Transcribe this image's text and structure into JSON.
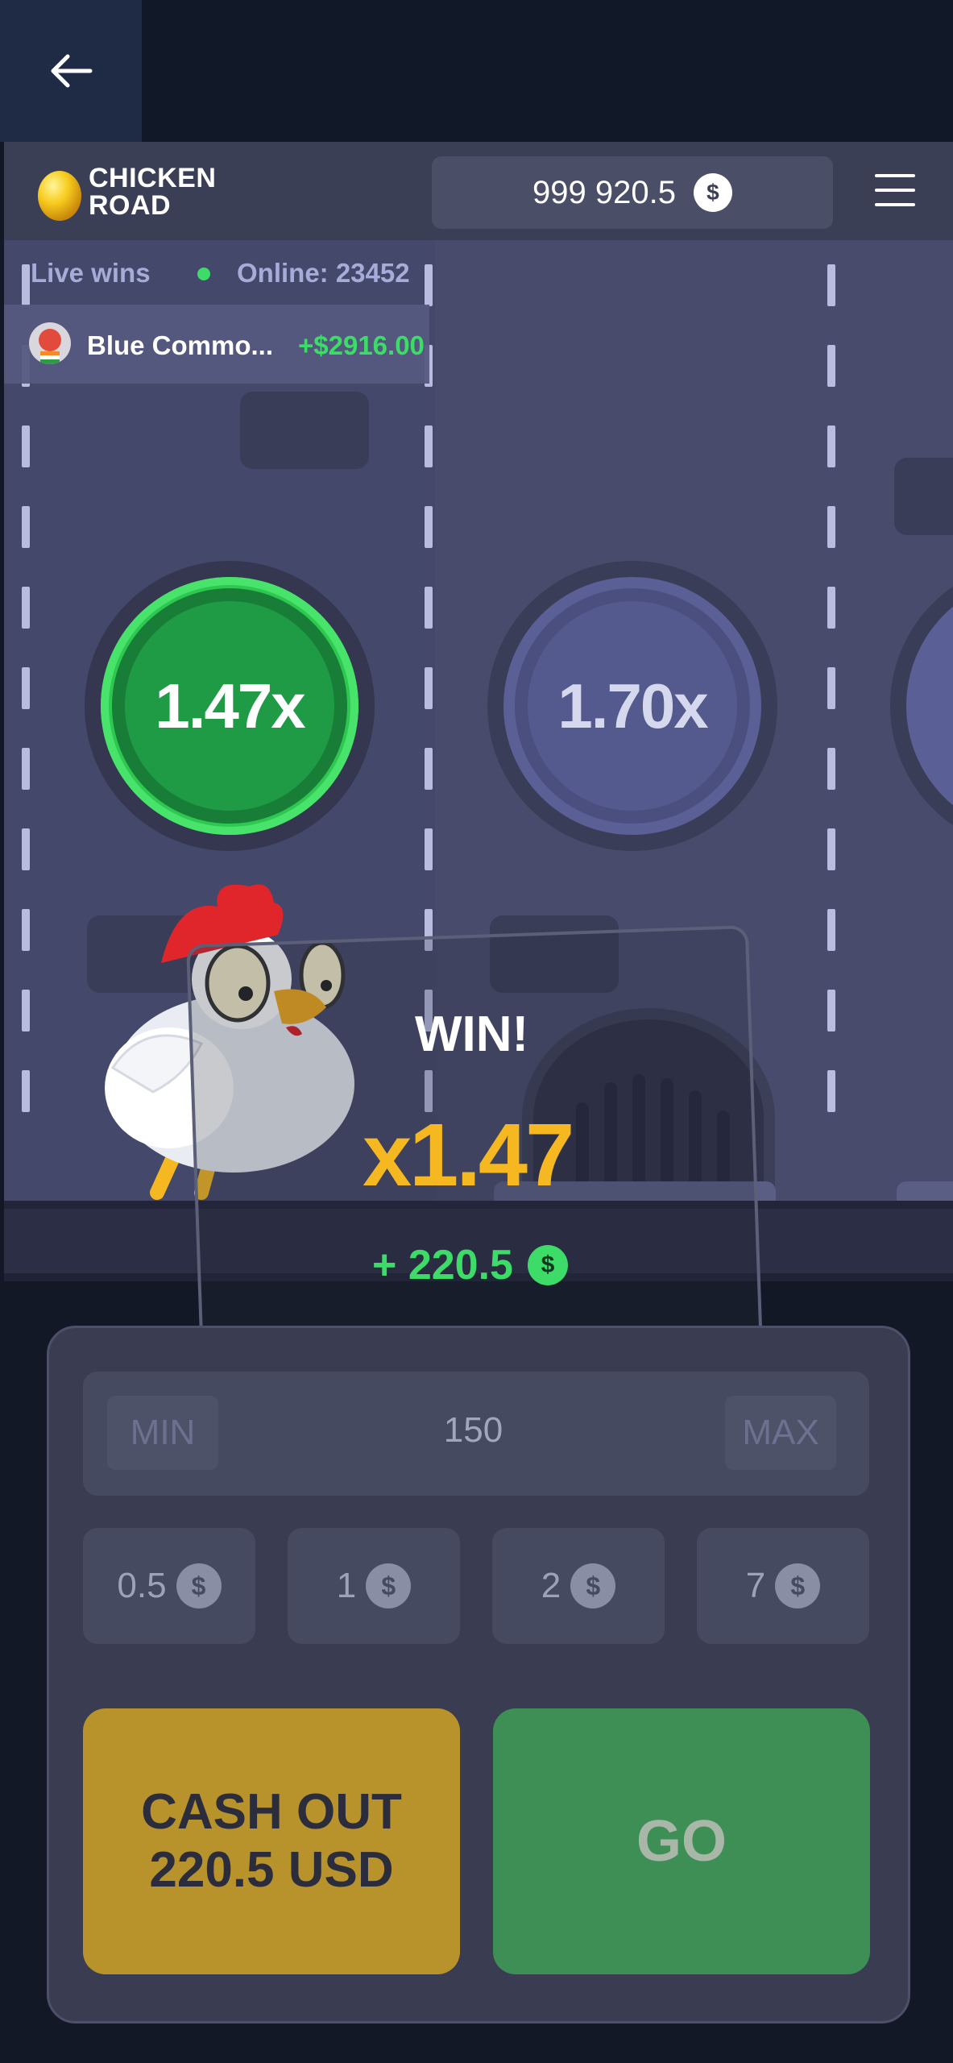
{
  "header": {
    "logo_line1": "CHICKEN",
    "logo_line2": "ROAD",
    "balance": "999 920.5",
    "currency_symbol": "$"
  },
  "live": {
    "label": "Live wins",
    "online": "Online: 23452",
    "winner_name": "Blue Commo...",
    "winner_amount": "+$2916.00"
  },
  "game": {
    "multipliers": [
      "1.47x",
      "1.70x"
    ],
    "win_title": "WIN!",
    "win_multiplier": "x1.47",
    "win_amount": "+ 220.5"
  },
  "controls": {
    "min_label": "MIN",
    "max_label": "MAX",
    "bet_value": "150",
    "quick_bets": [
      "0.5",
      "1",
      "2",
      "7"
    ],
    "cashout_line1": "CASH OUT",
    "cashout_line2": "220.5 USD",
    "go_label": "GO"
  },
  "colors": {
    "accent_green": "#3ddc68",
    "win_gold": "#f5b820",
    "cashout": "#b8922b",
    "go": "#3d8f56"
  }
}
